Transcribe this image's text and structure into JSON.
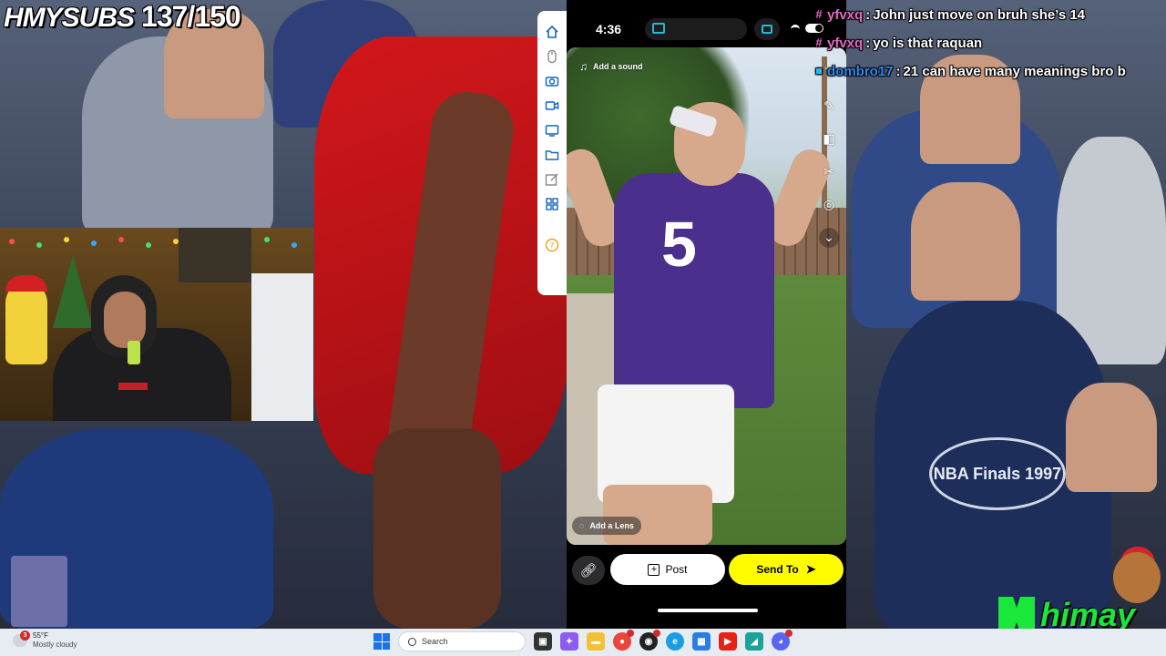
{
  "overlay": {
    "subs_label": "HMYSUBS",
    "subs_count": "137/150",
    "brand": "himay"
  },
  "phone": {
    "status_time": "4:36",
    "add_sound": "Add a sound",
    "add_lens": "Add a Lens",
    "post_label": "Post",
    "send_label": "Send To",
    "jersey_number": "5"
  },
  "chat": [
    {
      "user": "yfvxq",
      "message": "John just move on bruh she’s 14",
      "user_color": "#e468c4",
      "icon": "hashtag-icon"
    },
    {
      "user": "yfvxq",
      "message": "yo is that raquan",
      "user_color": "#e468c4",
      "icon": "hashtag-icon"
    },
    {
      "user": "dombro17",
      "message": "21 can have many meanings bro b",
      "user_color": "#2f8cf0",
      "icon": "cube-icon"
    }
  ],
  "scene": {
    "finals_text": "NBA Finals 1997"
  },
  "taskbar": {
    "weather_badge": "3",
    "temperature": "55°F",
    "condition": "Mostly cloudy",
    "search_placeholder": "Search"
  },
  "colors": {
    "snap_yellow": "#fffc00",
    "brand_green": "#19e83a",
    "bulls_red": "#d3171b",
    "jersey_purple": "#4b2f8c"
  }
}
